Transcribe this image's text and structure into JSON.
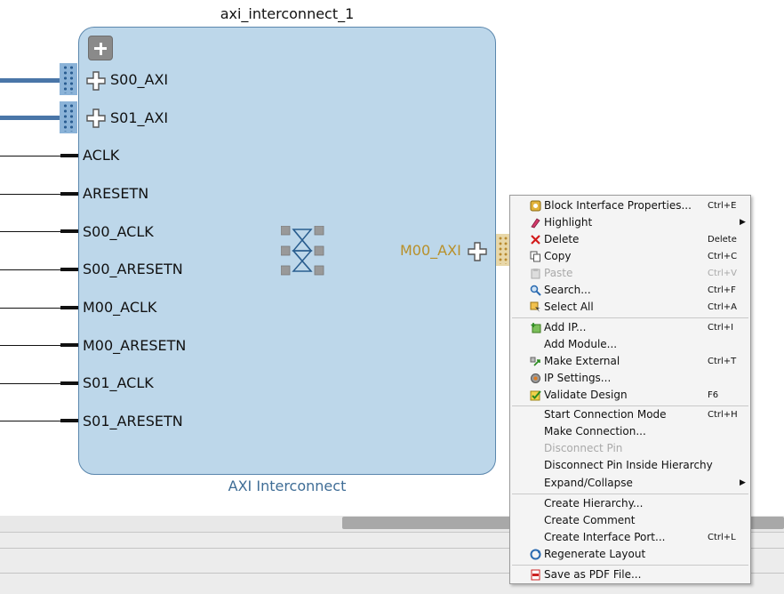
{
  "block": {
    "instance_name": "axi_interconnect_1",
    "ip_name": "AXI Interconnect",
    "interface_ports": [
      "S00_AXI",
      "S01_AXI"
    ],
    "pins": [
      "ACLK",
      "ARESETN",
      "S00_ACLK",
      "S00_ARESETN",
      "M00_ACLK",
      "M00_ARESETN",
      "S01_ACLK",
      "S01_ARESETN"
    ],
    "master_port": "M00_AXI"
  },
  "colors": {
    "block_fill": "#bdd7ea",
    "bus": "#4a76a8",
    "master_port_label": "#b8902a",
    "subtitle": "#3f6d96"
  },
  "context_menu": {
    "items": [
      {
        "label": "Block Interface Properties...",
        "shortcut": "Ctrl+E",
        "icon": "properties-icon"
      },
      {
        "label": "Highlight",
        "shortcut": "",
        "icon": "highlight-icon",
        "submenu": true
      },
      {
        "label": "Delete",
        "shortcut": "Delete",
        "icon": "delete-icon"
      },
      {
        "label": "Copy",
        "shortcut": "Ctrl+C",
        "icon": "copy-icon"
      },
      {
        "label": "Paste",
        "shortcut": "Ctrl+V",
        "icon": "paste-icon",
        "disabled": true
      },
      {
        "label": "Search...",
        "shortcut": "Ctrl+F",
        "icon": "search-icon"
      },
      {
        "label": "Select All",
        "shortcut": "Ctrl+A",
        "icon": "select-all-icon"
      },
      {
        "label": "Add IP...",
        "shortcut": "Ctrl+I",
        "icon": "add-ip-icon"
      },
      {
        "label": "Add Module...",
        "shortcut": "",
        "icon": ""
      },
      {
        "label": "Make External",
        "shortcut": "Ctrl+T",
        "icon": "make-external-icon"
      },
      {
        "label": "IP Settings...",
        "shortcut": "",
        "icon": "settings-icon"
      },
      {
        "label": "Validate Design",
        "shortcut": "F6",
        "icon": "validate-icon"
      },
      {
        "label": "Start Connection Mode",
        "shortcut": "Ctrl+H",
        "icon": ""
      },
      {
        "label": "Make Connection...",
        "shortcut": "",
        "icon": ""
      },
      {
        "label": "Disconnect Pin",
        "shortcut": "",
        "icon": "",
        "disabled": true
      },
      {
        "label": "Disconnect Pin Inside Hierarchy",
        "shortcut": "",
        "icon": ""
      },
      {
        "label": "Expand/Collapse",
        "shortcut": "",
        "icon": "",
        "submenu": true
      },
      {
        "label": "Create Hierarchy...",
        "shortcut": "",
        "icon": ""
      },
      {
        "label": "Create Comment",
        "shortcut": "",
        "icon": ""
      },
      {
        "label": "Create Interface Port...",
        "shortcut": "Ctrl+L",
        "icon": ""
      },
      {
        "label": "Regenerate Layout",
        "shortcut": "",
        "icon": "regenerate-icon"
      },
      {
        "label": "Save as PDF File...",
        "shortcut": "",
        "icon": "pdf-icon"
      }
    ]
  }
}
